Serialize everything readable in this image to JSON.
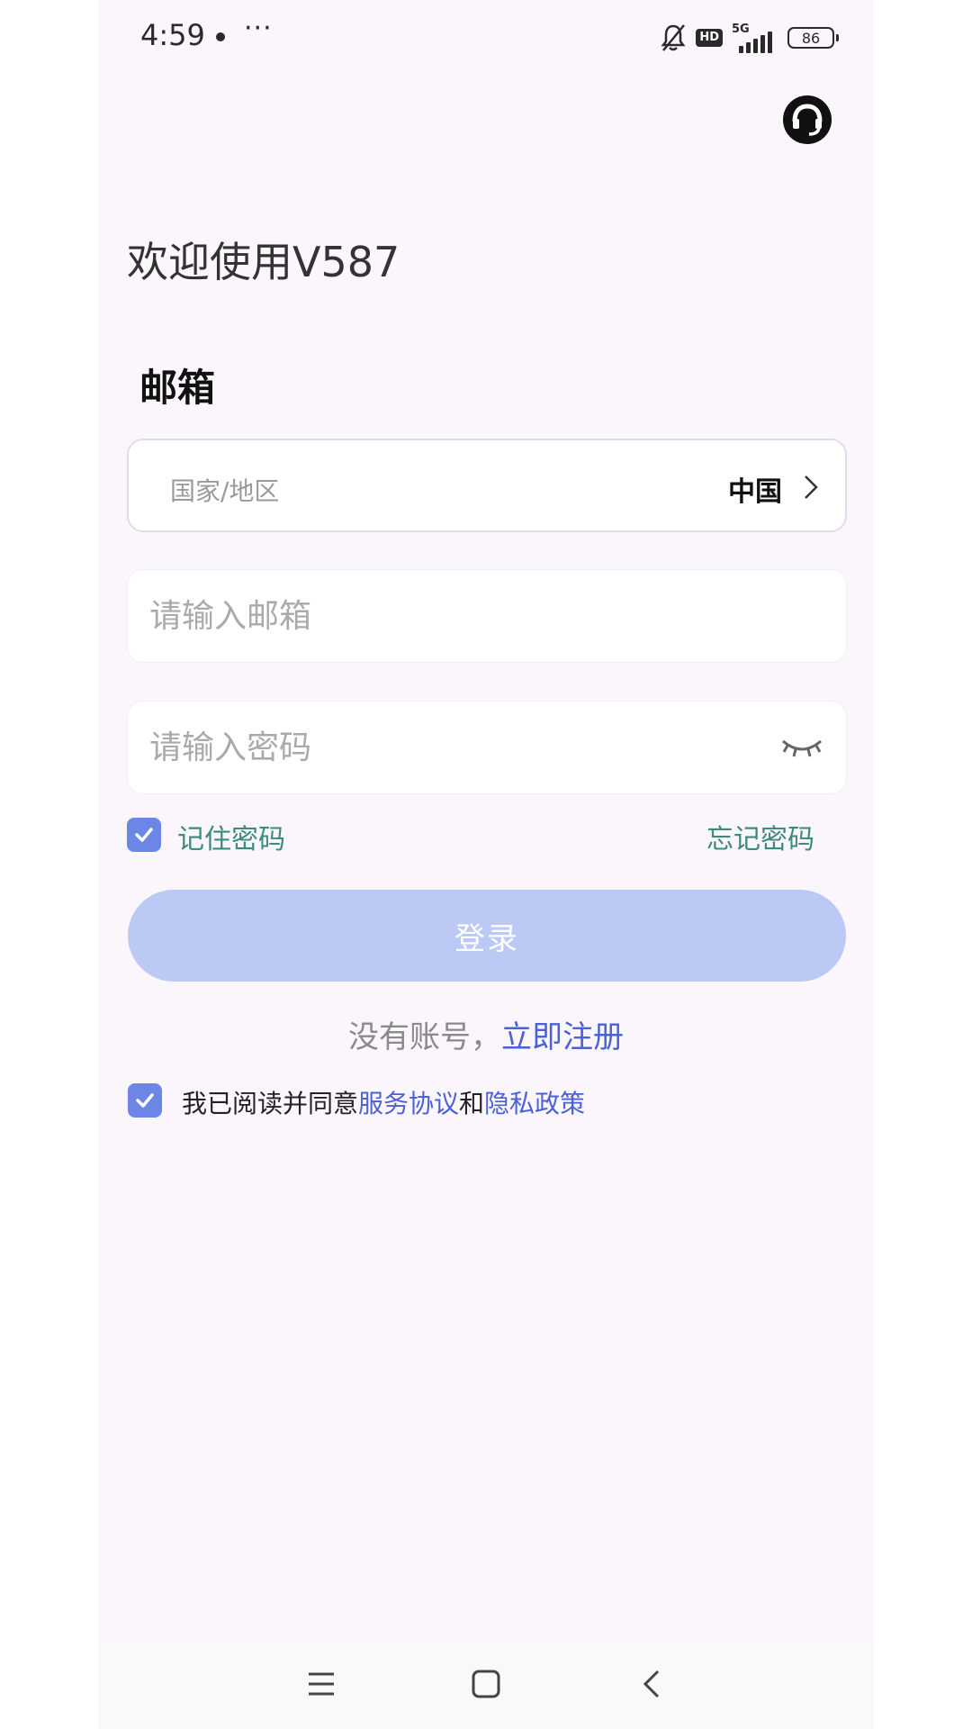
{
  "status_bar": {
    "time": "4:59",
    "more": "···",
    "network": "5G",
    "hd": "HD",
    "battery": "86"
  },
  "header": {
    "welcome": "欢迎使用V587",
    "section_label": "邮箱"
  },
  "form": {
    "country_label": "国家/地区",
    "country_value": "中国",
    "email_placeholder": "请输入邮箱",
    "password_placeholder": "请输入密码",
    "remember_label": "记住密码",
    "remember_checked": true,
    "forgot_label": "忘记密码",
    "login_label": "登录"
  },
  "register": {
    "prompt": "没有账号，",
    "link": "立即注册"
  },
  "agreement": {
    "checked": true,
    "prefix": "我已阅读并同意",
    "service_link": "服务协议",
    "and": "和",
    "privacy_link": "隐私政策"
  },
  "colors": {
    "accent": "#6b86e6",
    "link": "#4a62d6",
    "teal_text": "#3d8a7e",
    "login_button": "#bcc9f4",
    "background": "#fbf5fc"
  },
  "icons": {
    "support": "customer-service-icon",
    "eye": "eye-closed-icon",
    "nav_menu": "menu-icon",
    "nav_home": "home-icon",
    "nav_back": "back-icon"
  }
}
